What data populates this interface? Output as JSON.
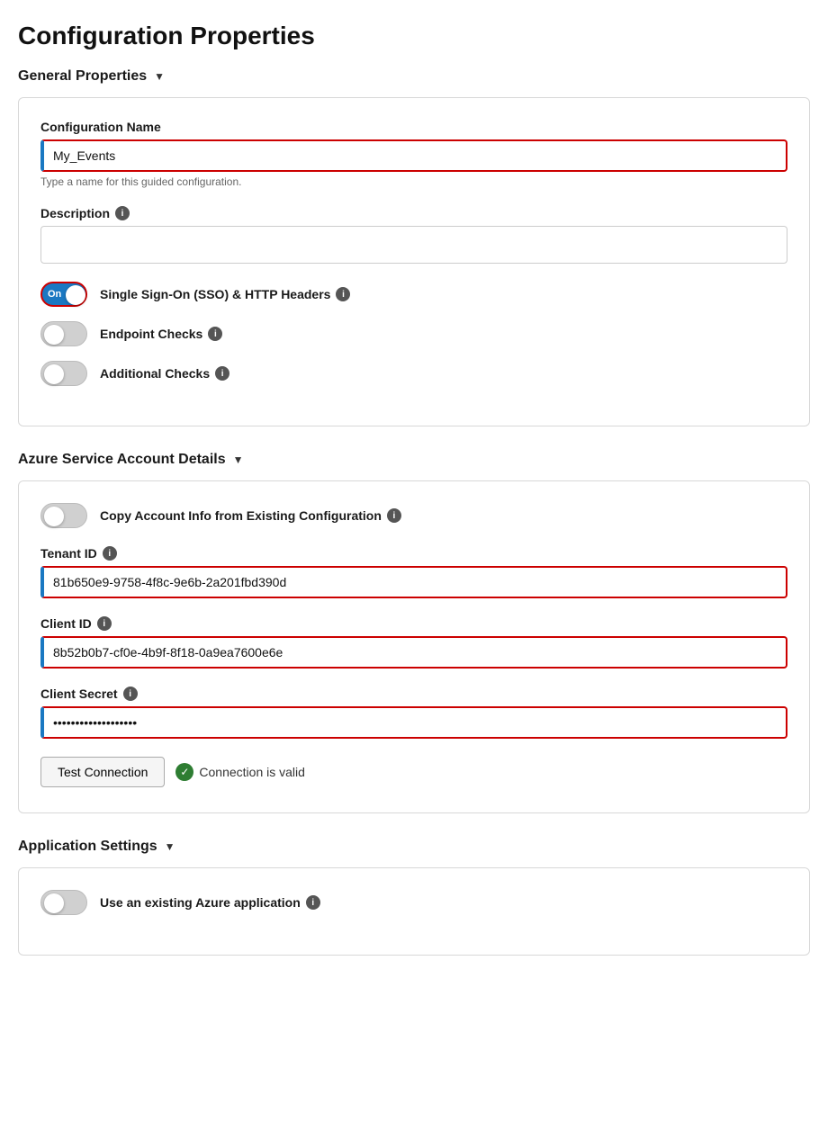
{
  "page": {
    "title": "Configuration Properties"
  },
  "general_properties": {
    "section_label": "General Properties",
    "config_name": {
      "label": "Configuration Name",
      "value": "My_Events",
      "hint": "Type a name for this guided configuration."
    },
    "description": {
      "label": "Description",
      "info": true,
      "value": ""
    },
    "sso_toggle": {
      "label": "Single Sign-On (SSO) & HTTP Headers",
      "state": "on",
      "state_label": "On",
      "info": true
    },
    "endpoint_checks": {
      "label": "Endpoint Checks",
      "state": "off",
      "info": true
    },
    "additional_checks": {
      "label": "Additional Checks",
      "state": "off",
      "info": true
    }
  },
  "azure_account": {
    "section_label": "Azure Service Account Details",
    "copy_toggle": {
      "label": "Copy Account Info from Existing Configuration",
      "state": "off",
      "info": true
    },
    "tenant_id": {
      "label": "Tenant ID",
      "value": "81b650e9-9758-4f8c-9e6b-2a201fbd390d",
      "info": true
    },
    "client_id": {
      "label": "Client ID",
      "value": "8b52b0b7-cf0e-4b9f-8f18-0a9ea7600e6e",
      "info": true
    },
    "client_secret": {
      "label": "Client Secret",
      "value": "••••••••••••••••••••••••••••••",
      "info": true
    },
    "test_connection_btn": "Test Connection",
    "connection_status": "Connection is valid"
  },
  "application_settings": {
    "section_label": "Application Settings",
    "use_existing_toggle": {
      "label": "Use an existing Azure application",
      "state": "off",
      "info": true
    }
  },
  "icons": {
    "info": "i",
    "check": "✓",
    "chevron_down": "▼"
  }
}
